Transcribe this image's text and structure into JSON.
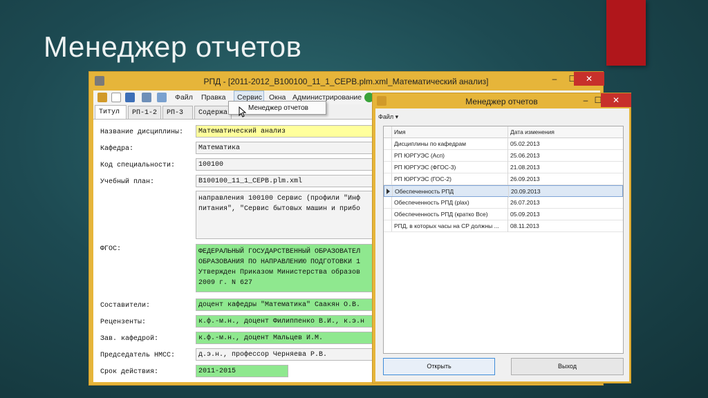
{
  "slide": {
    "title": "Менеджер отчетов"
  },
  "main_window": {
    "title": "РПД - [2011-2012_B100100_11_1_CEPB.plm.xml_Математический анализ]",
    "controls": {
      "minimize": "–",
      "maximize": "☐",
      "close": "✕"
    },
    "menu": [
      "Файл",
      "Правка",
      "Сервис",
      "Окна",
      "Администрирование"
    ],
    "tabs": [
      "Титул",
      "РП-1-2",
      "РП-3",
      "Содержа"
    ],
    "fields": [
      {
        "label": "Название дисциплины:",
        "value": "Математический анализ"
      },
      {
        "label": "Кафедра:",
        "value": "Математика"
      },
      {
        "label": "Код специальности:",
        "value": "100100"
      },
      {
        "label": "Учебный план:",
        "value": "B100100_11_1_CEPB.plm.xml"
      },
      {
        "label": "",
        "value": "направления 100100 Сервис (профили \"Инф питания\", \"Сервис бытовых машин и прибо"
      },
      {
        "label": "ФГОС:",
        "value": "ФЕДЕРАЛЬНЫЙ ГОСУДАРСТВЕННЫЙ ОБРАЗОВАТЕЛ ОБРАЗОВАНИЯ ПО НАПРАВЛЕНИЮ ПОДГОТОВКИ 1 Утвержден Приказом Министерства образов 2009 г. N 627"
      },
      {
        "label": "Составители:",
        "value": "доцент кафедры \"Математика\" Саакян О.В."
      },
      {
        "label": "Рецензенты:",
        "value": "к.ф.-м.н., доцент Филиппенко В.И., к.э.н"
      },
      {
        "label": "Зав. кафедрой:",
        "value": "к.ф.-м.н., доцент Мальцев И.М."
      },
      {
        "label": "Председатель НМСС:",
        "value": "д.э.н., профессор Черняева Р.В."
      },
      {
        "label": "Срок действия:",
        "value": "2011-2015"
      }
    ],
    "dropdown_item": "Менеджер отчетов"
  },
  "report_window": {
    "title": "Менеджер отчетов",
    "controls": {
      "minimize": "–",
      "maximize": "☐",
      "close": "✕"
    },
    "file_menu": "Файл ▾",
    "columns": [
      "Имя",
      "Дата изменения"
    ],
    "rows": [
      {
        "name": "Дисциплины по кафедрам",
        "date": "05.02.2013"
      },
      {
        "name": "РП ЮРГУЭС (Асп)",
        "date": "25.06.2013"
      },
      {
        "name": "РП ЮРГУЭС (ФГОС-3)",
        "date": "21.08.2013"
      },
      {
        "name": "РП ЮРГУЭС (ГОС-2)",
        "date": "26.09.2013"
      },
      {
        "name": "Обеспеченность РПД",
        "date": "20.09.2013"
      },
      {
        "name": "Обеспеченность РПД (plax)",
        "date": "26.07.2013"
      },
      {
        "name": "Обеспеченность РПД (кратко Все)",
        "date": "05.09.2013"
      },
      {
        "name": "РПД, в которых часы на СР должны ...",
        "date": "08.11.2013"
      }
    ],
    "selected_row": 4,
    "buttons": {
      "open": "Открыть",
      "exit": "Выход"
    }
  }
}
